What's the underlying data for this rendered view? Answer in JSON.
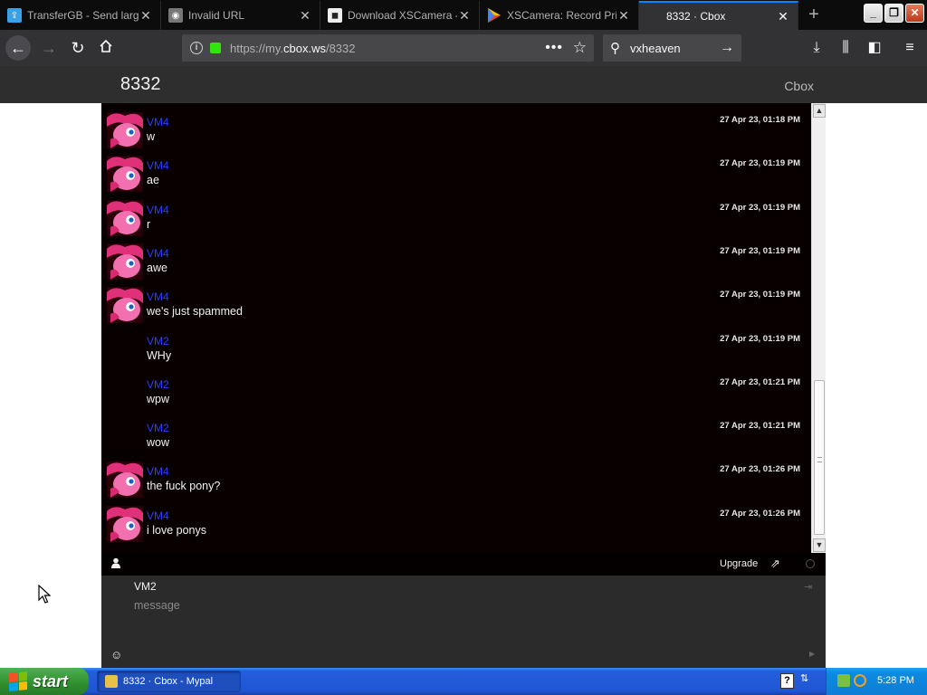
{
  "browser": {
    "tabs": [
      {
        "title": "TransferGB - Send large",
        "favicon": "transfergb-icon",
        "fav_color": "#3aa0e8"
      },
      {
        "title": "Invalid URL",
        "favicon": "globe-icon",
        "fav_color": "#777777"
      },
      {
        "title": "Download XSCamera - U",
        "favicon": "camera-icon",
        "fav_color": "#222222"
      },
      {
        "title": "XSCamera: Record Prin",
        "favicon": "google-play-icon",
        "fav_color": "#34a853"
      },
      {
        "title": "8332 · Cbox",
        "favicon": "none",
        "fav_color": "#323234"
      }
    ],
    "new_tab": "+",
    "url_base": "https://my.",
    "url_domain": "cbox.ws",
    "url_path": "/8332",
    "search_value": "vxheaven",
    "window_controls": {
      "minimize": "_",
      "restore": "❐",
      "close": "✕"
    }
  },
  "site": {
    "box_name": "8332",
    "brand": "Cbox"
  },
  "chat": {
    "messages": [
      {
        "user": "VM4",
        "text": "w",
        "time": "27 Apr 23, 01:18 PM",
        "avatar": true
      },
      {
        "user": "VM4",
        "text": "ae",
        "time": "27 Apr 23, 01:19 PM",
        "avatar": true
      },
      {
        "user": "VM4",
        "text": "r",
        "time": "27 Apr 23, 01:19 PM",
        "avatar": true
      },
      {
        "user": "VM4",
        "text": "awe",
        "time": "27 Apr 23, 01:19 PM",
        "avatar": true
      },
      {
        "user": "VM4",
        "text": "we's just spammed",
        "time": "27 Apr 23, 01:19 PM",
        "avatar": true
      },
      {
        "user": "VM2",
        "text": "WHy",
        "time": "27 Apr 23, 01:19 PM",
        "avatar": false
      },
      {
        "user": "VM2",
        "text": "wpw",
        "time": "27 Apr 23, 01:21 PM",
        "avatar": false
      },
      {
        "user": "VM2",
        "text": "wow",
        "time": "27 Apr 23, 01:21 PM",
        "avatar": false
      },
      {
        "user": "VM4",
        "text": "the fuck pony?",
        "time": "27 Apr 23, 01:26 PM",
        "avatar": true
      },
      {
        "user": "VM4",
        "text": "i love ponys",
        "time": "27 Apr 23, 01:26 PM",
        "avatar": true
      }
    ],
    "toolbar": {
      "upgrade_label": "Upgrade"
    },
    "post": {
      "name": "VM2",
      "message_placeholder": "message",
      "message_value": ""
    }
  },
  "taskbar": {
    "start_label": "start",
    "task_item": "8332 · Cbox - Mypal",
    "clock": "5:28 PM"
  },
  "colors": {
    "username": "#2f3bff",
    "chat_bg": "#080000",
    "active_tab_accent": "#0a84ff"
  }
}
